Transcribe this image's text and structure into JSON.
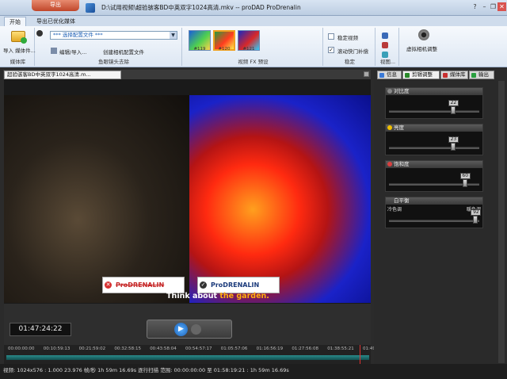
{
  "app": {
    "menu_button": "导出",
    "window_title": "D:\\试用视频\\超验骇客BD中英双字1024高清.mkv -- proDAD ProDrenalin",
    "win_controls": [
      "?",
      "–",
      "❐",
      "✕"
    ]
  },
  "tabs": [
    {
      "label": "开始",
      "active": true
    },
    {
      "label": "导出已优化媒体",
      "active": false
    }
  ],
  "ribbon": {
    "media_library": {
      "import_label": "导入 媒体件...",
      "group_label": "媒体库"
    },
    "fisheye": {
      "preset_select": "*** 选择配置文件 ***",
      "edit_import": "编辑/导入...",
      "create_camera_profile": "创建相机配置文件",
      "group_label": "鱼眼镜头去除"
    },
    "fx": {
      "presets": [
        {
          "label": "#119",
          "colors": [
            "#1a5fd8",
            "#4fd04f",
            "#ffd34a"
          ]
        },
        {
          "label": "#120",
          "colors": [
            "#2a9a3a",
            "#ff3c1e",
            "#ffe84a"
          ],
          "selected": true
        },
        {
          "label": "#121",
          "colors": [
            "#1a28c0",
            "#d82828",
            "#2ad0ff"
          ]
        }
      ],
      "group_label": "视频 FX 预设"
    },
    "stabilize": {
      "stabilize_video": "稳定视频",
      "rolling_shutter": "滚动快门补偿",
      "group_label": "稳定"
    },
    "view_group_label": "视图...",
    "virtual_camera": "虚拟相机调整"
  },
  "video_panel": {
    "tab_label": "超验骇客BD中英双字1024高清.m...",
    "watermark_before": "ProDRENALIN",
    "watermark_after": "ProDRENALIN",
    "sub_white": "Think about ",
    "sub_orange": "the garden."
  },
  "controls": {
    "timecode": "01:47:24:22"
  },
  "timeline": {
    "ticks": [
      "00:00:00:00",
      "00:10:59:13",
      "00:21:59:02",
      "00:32:58:15",
      "00:43:58:04",
      "00:54:57:17",
      "01:05:57:06",
      "01:16:56:19",
      "01:27:56:08",
      "01:38:55:21",
      "01:49:55:10"
    ],
    "playhead": 0.974
  },
  "status": {
    "text": "视频: 1024x576 : 1.000  23.976 帧/秒  1h 59m 16.69s  逐行扫描  范围: 00:00:00:00 至 01:58:19:21 : 1h 59m 16.69s"
  },
  "side_panel": {
    "tabs": [
      {
        "label": "信息",
        "color": "#3a7ad8"
      },
      {
        "label": "剪辑调整",
        "color": "#2a8a2a",
        "active": true
      },
      {
        "label": "媒体库",
        "color": "#c83030"
      },
      {
        "label": "输出",
        "color": "#2aa040"
      }
    ],
    "sliders": [
      {
        "label": "对比度",
        "value": "22",
        "dot": "#888888",
        "pos": 0.71
      },
      {
        "label": "亮度",
        "value": "23",
        "dot": "#f0c000",
        "pos": 0.71
      },
      {
        "label": "饱和度",
        "value": "60",
        "dot": "#d84040",
        "pos": 0.84
      },
      {
        "label": "白平衡",
        "value": "92",
        "dot": "",
        "pos": 0.96,
        "left_label": "冷色调",
        "right_label": "暖色调"
      }
    ]
  },
  "colors": {
    "accent": "#1c5fb5",
    "timeline": "#2a8a8a"
  }
}
